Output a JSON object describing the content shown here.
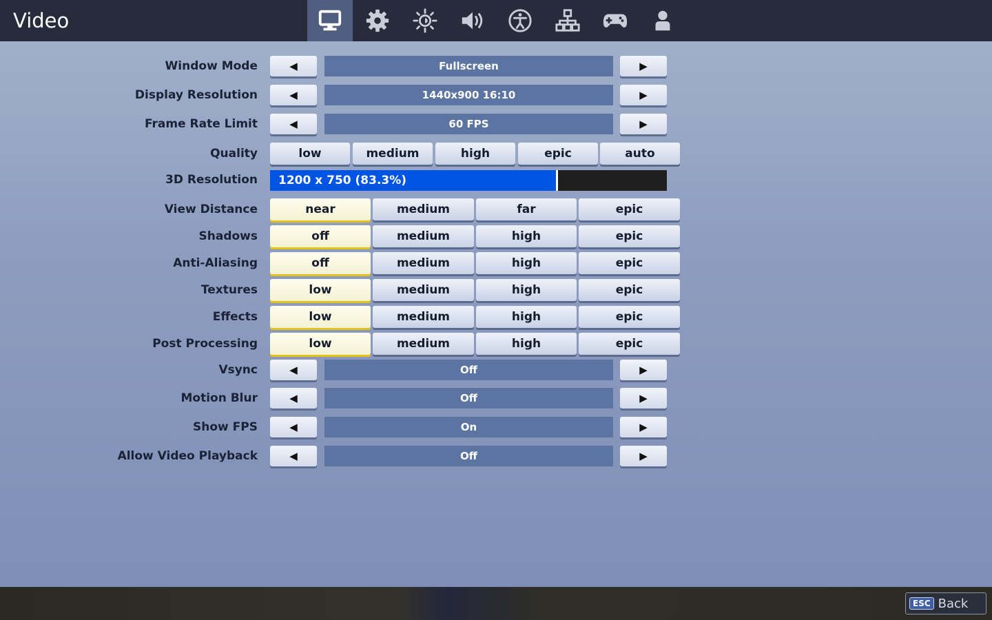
{
  "header": {
    "title": "Video",
    "tabs": [
      {
        "icon": "monitor-icon",
        "active": true
      },
      {
        "icon": "gear-icon",
        "active": false
      },
      {
        "icon": "brightness-icon",
        "active": false
      },
      {
        "icon": "speaker-icon",
        "active": false
      },
      {
        "icon": "accessibility-icon",
        "active": false
      },
      {
        "icon": "network-icon",
        "active": false
      },
      {
        "icon": "gamepad-icon",
        "active": false
      },
      {
        "icon": "account-icon",
        "active": false
      }
    ]
  },
  "arrows": {
    "left": "◀",
    "right": "▶"
  },
  "settings": {
    "window_mode": {
      "label": "Window Mode",
      "value": "Fullscreen"
    },
    "display_resolution": {
      "label": "Display Resolution",
      "value": "1440x900 16:10"
    },
    "frame_rate_limit": {
      "label": "Frame Rate Limit",
      "value": "60 FPS"
    },
    "quality": {
      "label": "Quality",
      "options": [
        "low",
        "medium",
        "high",
        "epic",
        "auto"
      ]
    },
    "resolution_3d": {
      "label": "3D Resolution",
      "value": "1200 x 750 (83.3%)",
      "fraction": 0.72
    },
    "view_distance": {
      "label": "View Distance",
      "options": [
        "near",
        "medium",
        "far",
        "epic"
      ],
      "selected": "near"
    },
    "shadows": {
      "label": "Shadows",
      "options": [
        "off",
        "medium",
        "high",
        "epic"
      ],
      "selected": "off"
    },
    "anti_aliasing": {
      "label": "Anti-Aliasing",
      "options": [
        "off",
        "medium",
        "high",
        "epic"
      ],
      "selected": "off"
    },
    "textures": {
      "label": "Textures",
      "options": [
        "low",
        "medium",
        "high",
        "epic"
      ],
      "selected": "low"
    },
    "effects": {
      "label": "Effects",
      "options": [
        "low",
        "medium",
        "high",
        "epic"
      ],
      "selected": "low"
    },
    "post_processing": {
      "label": "Post Processing",
      "options": [
        "low",
        "medium",
        "high",
        "epic"
      ],
      "selected": "low"
    },
    "vsync": {
      "label": "Vsync",
      "value": "Off"
    },
    "motion_blur": {
      "label": "Motion Blur",
      "value": "Off"
    },
    "show_fps": {
      "label": "Show FPS",
      "value": "On"
    },
    "allow_video_playback": {
      "label": "Allow Video Playback",
      "value": "Off"
    }
  },
  "footer": {
    "esc_key": "ESC",
    "back_label": "Back"
  },
  "colors": {
    "accent_blue": "#0054e3",
    "selected_underline": "#e2c21c",
    "topbar": "#262c3b"
  }
}
